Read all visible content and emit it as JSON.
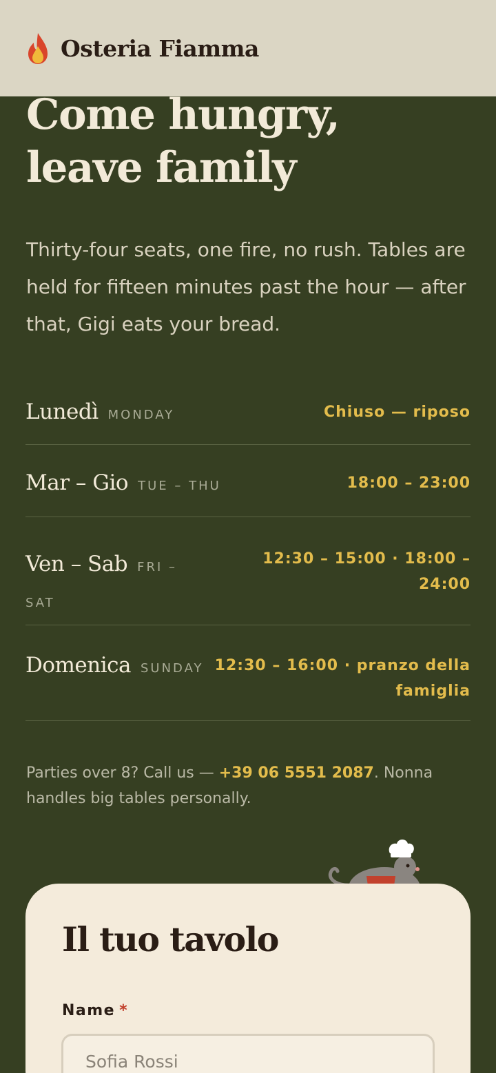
{
  "header": {
    "brand": "Osteria Fiamma",
    "logo_icon": "flame-icon"
  },
  "hero": {
    "title_line1": "Come hungry,",
    "title_line2": "leave family",
    "lede": "Thirty-four seats, one fire, no rush. Tables are held for fifteen minutes past the hour — after that, Gigi eats your bread."
  },
  "hours": [
    {
      "day_it": "Lunedì",
      "day_en": "MONDAY",
      "time": "Chiuso — riposo"
    },
    {
      "day_it": "Mar – Gio",
      "day_en": "TUE – THU",
      "time": "18:00 – 23:00"
    },
    {
      "day_it": "Ven – Sab",
      "day_en": "FRI – SAT",
      "time": "12:30 – 15:00 · 18:00 – 24:00"
    },
    {
      "day_it": "Domenica",
      "day_en": "SUNDAY",
      "time": "12:30 – 16:00 · pranzo della famiglia"
    }
  ],
  "note": {
    "before": "Parties over 8? Call us — ",
    "phone": "+39 06 5551 2087",
    "after": ". Nonna handles big tables personally."
  },
  "reservation": {
    "title": "Il tuo tavolo",
    "name_label": "Name",
    "required_mark": "*",
    "name_placeholder": "Sofia Rossi"
  },
  "colors": {
    "background": "#363f22",
    "header": "#dbd6c4",
    "accent": "#e3bc4c",
    "card": "#f4ebdb",
    "ink": "#2a1d15"
  }
}
